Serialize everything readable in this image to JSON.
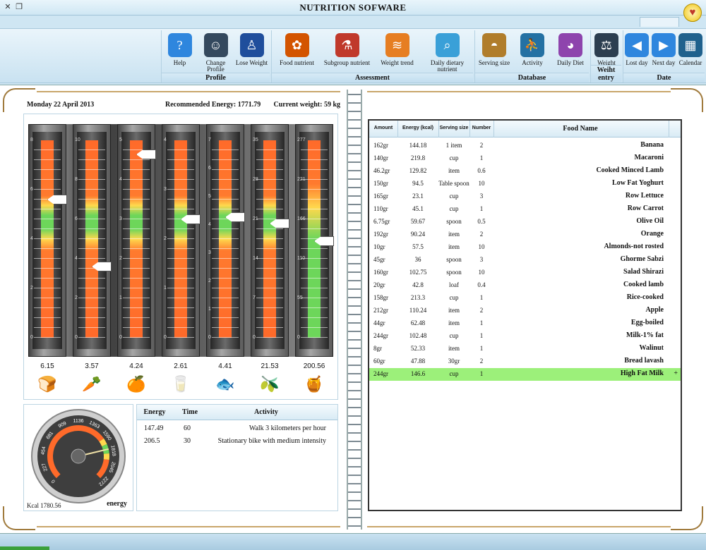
{
  "app": {
    "title": "NUTRITION SOFWARE",
    "accent": "#cfe6f3"
  },
  "ribbon": {
    "groups": [
      {
        "label": "Profile",
        "buttons": [
          {
            "label": "Help",
            "icon": "help-icon"
          },
          {
            "label": "Change Profile",
            "icon": "profile-icon"
          },
          {
            "label": "Lose Weight",
            "icon": "person-icon"
          }
        ]
      },
      {
        "label": "Assessment",
        "buttons": [
          {
            "label": "Food nutrient",
            "icon": "molecule-icon"
          },
          {
            "label": "Subgroup nutrient",
            "icon": "tube-icon"
          },
          {
            "label": "Weight trend",
            "icon": "trend-chart-icon"
          },
          {
            "label": "Daily dietary nutrient",
            "icon": "magnifier-icon"
          }
        ]
      },
      {
        "label": "Database",
        "buttons": [
          {
            "label": "Serving size",
            "icon": "bowl-icon"
          },
          {
            "label": "Activity",
            "icon": "runner-icon"
          },
          {
            "label": "Daily Diet",
            "icon": "pie-icon"
          }
        ]
      },
      {
        "label": "Weiht entry",
        "buttons": [
          {
            "label": "Weight",
            "icon": "scale-icon"
          }
        ]
      },
      {
        "label": "Date",
        "buttons": [
          {
            "label": "Lost day",
            "icon": "arrow-left-icon"
          },
          {
            "label": "Next day",
            "icon": "arrow-right-icon"
          },
          {
            "label": "Calendar",
            "icon": "calendar-icon"
          }
        ]
      }
    ]
  },
  "info": {
    "date": "Monday 22 April 2013",
    "recommended": "Recommended Energy: 1771.79",
    "weight": "Current weight: 59 kg"
  },
  "gauges": [
    {
      "value": "6.15",
      "level": 0.7,
      "icon": "bread-icon",
      "scale": [
        "8",
        "6",
        "4",
        "2",
        "0"
      ]
    },
    {
      "value": "3.57",
      "level": 0.36,
      "icon": "vegetables-icon",
      "scale": [
        "10",
        "8",
        "6",
        "4",
        "2",
        "0"
      ]
    },
    {
      "value": "4.24",
      "level": 0.93,
      "icon": "fruit-icon",
      "scale": [
        "5",
        "4",
        "3",
        "2",
        "1",
        "0"
      ]
    },
    {
      "value": "2.61",
      "level": 0.6,
      "icon": "milk-icon",
      "scale": [
        "4",
        "3",
        "2",
        "1",
        "0"
      ]
    },
    {
      "value": "4.41",
      "level": 0.61,
      "icon": "fish-icon",
      "scale": [
        "7",
        "6",
        "5",
        "4",
        "3",
        "2",
        "1",
        "0"
      ]
    },
    {
      "value": "21.53",
      "level": 0.58,
      "icon": "oil-icon",
      "scale": [
        "35",
        "28",
        "21",
        "14",
        "7",
        "0"
      ]
    },
    {
      "value": "200.56",
      "level": 0.49,
      "icon": "sweets-icon",
      "scale": [
        "277",
        "221",
        "166",
        "110",
        "55",
        "0"
      ]
    }
  ],
  "energy_gauge": {
    "kcal_label": "Kcal 1780.56",
    "name": "energy",
    "ticks": [
      "0",
      "227",
      "454",
      "681",
      "909",
      "1136",
      "1363",
      "1590",
      "1818",
      "2045",
      "2272"
    ],
    "value": 1780.56,
    "max": 2272
  },
  "activity": {
    "headers": [
      "Energy",
      "Time",
      "Activity"
    ],
    "rows": [
      {
        "energy": "147.49",
        "time": "60",
        "activity": "Walk 3 kilometers per hour"
      },
      {
        "energy": "206.5",
        "time": "30",
        "activity": "Stationary bike with medium intensity"
      }
    ]
  },
  "food": {
    "headers": [
      "Amount",
      "Energy (kcal)",
      "Serving size",
      "Number",
      "Food Name"
    ],
    "rows": [
      [
        "162gr",
        "144.18",
        "1 item",
        "2",
        "Banana"
      ],
      [
        "140gr",
        "219.8",
        "cup",
        "1",
        "Macaroni"
      ],
      [
        "46.2gr",
        "129.82",
        "item",
        "0.6",
        "Cooked Minced Lamb"
      ],
      [
        "150gr",
        "94.5",
        "Table spoon",
        "10",
        "Low Fat Yoghurt"
      ],
      [
        "165gr",
        "23.1",
        "cup",
        "3",
        "Row Lettuce"
      ],
      [
        "110gr",
        "45.1",
        "cup",
        "1",
        "Row Carrot"
      ],
      [
        "6.75gr",
        "59.67",
        "spoon",
        "0.5",
        "Olive Oil"
      ],
      [
        "192gr",
        "90.24",
        "item",
        "2",
        "Orange"
      ],
      [
        "10gr",
        "57.5",
        "item",
        "10",
        "Almonds-not rosted"
      ],
      [
        "45gr",
        "36",
        "spoon",
        "3",
        "Ghorme Sabzi"
      ],
      [
        "160gr",
        "102.75",
        "spoon",
        "10",
        "Salad Shirazi"
      ],
      [
        "20gr",
        "42.8",
        "loaf",
        "0.4",
        "Cooked lamb"
      ],
      [
        "158gr",
        "213.3",
        "cup",
        "1",
        "Rice-cooked"
      ],
      [
        "212gr",
        "110.24",
        "item",
        "2",
        "Apple"
      ],
      [
        "44gr",
        "62.48",
        "item",
        "1",
        "Egg-boiled"
      ],
      [
        "244gr",
        "102.48",
        "cup",
        "1",
        "Milk-1% fat"
      ],
      [
        "8gr",
        "52.33",
        "item",
        "1",
        "Walinut"
      ],
      [
        "60gr",
        "47.88",
        "30gr",
        "2",
        "Bread lavash"
      ],
      [
        "244gr",
        "146.6",
        "cup",
        "1",
        "High Fat Milk"
      ]
    ],
    "selected_index": 18,
    "selected_marker": "+"
  }
}
